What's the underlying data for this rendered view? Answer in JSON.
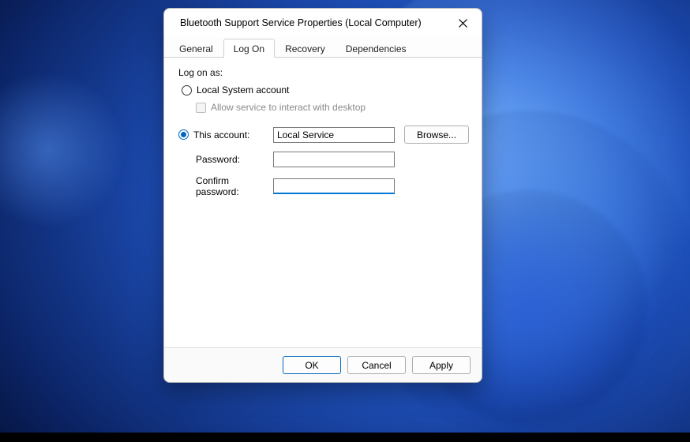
{
  "dialog": {
    "title": "Bluetooth Support Service Properties (Local Computer)"
  },
  "tabs": {
    "general": "General",
    "logon": "Log On",
    "recovery": "Recovery",
    "dependencies": "Dependencies",
    "active": "logon"
  },
  "logon": {
    "group_label": "Log on as:",
    "local_system_label": "Local System account",
    "allow_interact_label": "Allow service to interact with desktop",
    "allow_interact_enabled": false,
    "this_account_label": "This account:",
    "selected": "this_account",
    "account_value": "Local Service",
    "browse_label": "Browse...",
    "password_label": "Password:",
    "password_value": "",
    "confirm_label": "Confirm password:",
    "confirm_value": ""
  },
  "buttons": {
    "ok": "OK",
    "cancel": "Cancel",
    "apply": "Apply"
  }
}
